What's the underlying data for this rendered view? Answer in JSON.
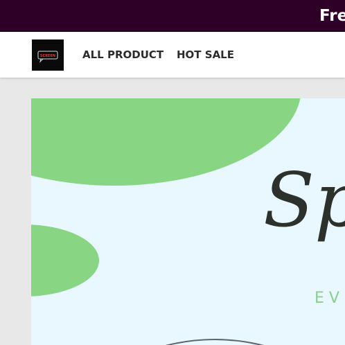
{
  "announcement": {
    "text": "Fre"
  },
  "header": {
    "logo_text": "SCREEN",
    "nav": [
      {
        "label": "ALL PRODUCT"
      },
      {
        "label": "HOT SALE"
      }
    ]
  },
  "hero": {
    "title": "Sp",
    "subtitle": "EVE"
  },
  "colors": {
    "announce_bg": "#2e0028",
    "hero_bg": "#e8f8fe",
    "blob_green": "#88d584",
    "subtitle_green": "#8ccf8c",
    "title_dark": "#2c312c"
  }
}
